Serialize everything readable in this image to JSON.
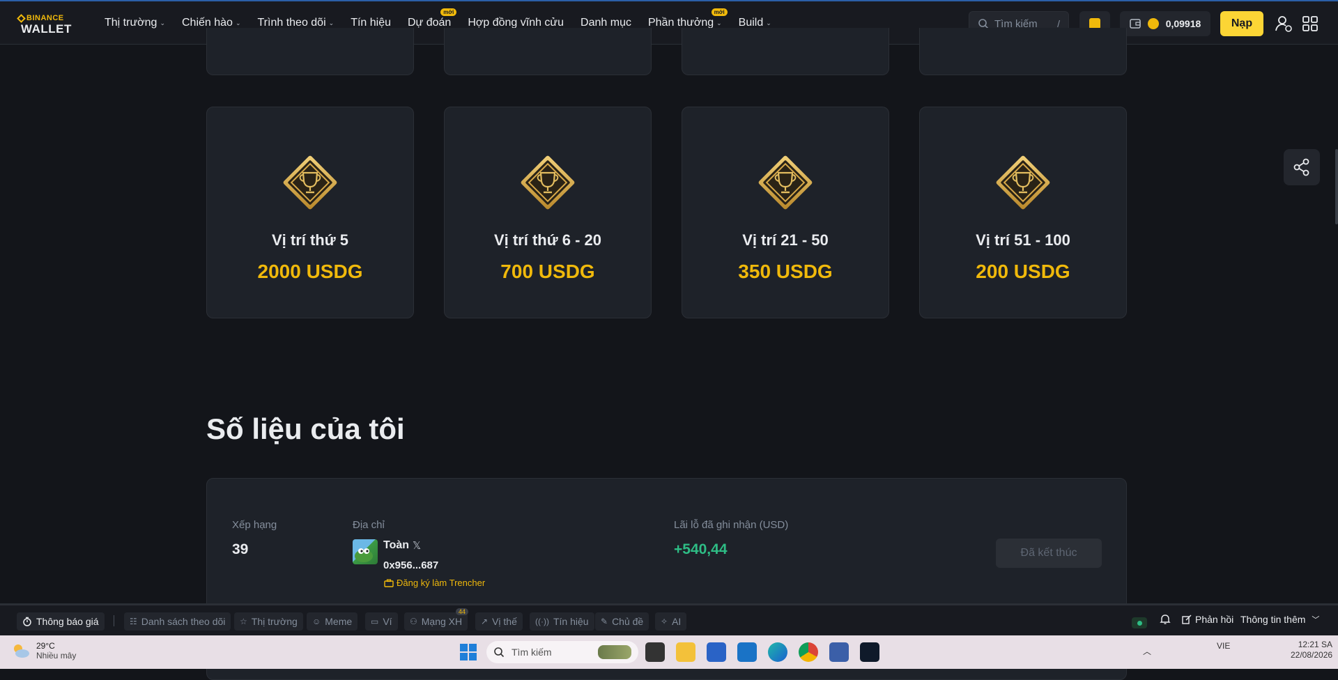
{
  "nav": {
    "logo_top": "BINANCE",
    "logo_bottom": "WALLET",
    "items": [
      {
        "label": "Thị trường",
        "dropdown": true,
        "badge": ""
      },
      {
        "label": "Chiến hào",
        "dropdown": true,
        "badge": ""
      },
      {
        "label": "Trình theo dõi",
        "dropdown": true,
        "badge": ""
      },
      {
        "label": "Tín hiệu",
        "dropdown": false,
        "badge": ""
      },
      {
        "label": "Dự đoán",
        "dropdown": false,
        "badge": "mới"
      },
      {
        "label": "Hợp đồng vĩnh cửu",
        "dropdown": false,
        "badge": ""
      },
      {
        "label": "Danh mục",
        "dropdown": false,
        "badge": ""
      },
      {
        "label": "Phần thưởng",
        "dropdown": true,
        "badge": "mới"
      },
      {
        "label": "Build",
        "dropdown": true,
        "badge": ""
      }
    ],
    "search_placeholder": "Tìm kiếm",
    "search_shortcut": "/",
    "balance": "0,09918",
    "deposit_label": "Nạp"
  },
  "prizes": [
    {
      "position": "Vị trí thứ 5",
      "amount": "2000 USDG"
    },
    {
      "position": "Vị trí thứ 6 - 20",
      "amount": "700 USDG"
    },
    {
      "position": "Vị trí 21 - 50",
      "amount": "350 USDG"
    },
    {
      "position": "Vị trí 51 - 100",
      "amount": "200 USDG"
    }
  ],
  "my_stats": {
    "title": "Số liệu của tôi",
    "rank_label": "Xếp hạng",
    "rank_value": "39",
    "address_label": "Địa chỉ",
    "user_name": "Toàn",
    "address_value": "0x956...687",
    "register_trencher": "Đăng ký làm Trencher",
    "pnl_label": "Lãi lỗ đã ghi nhận (USD)",
    "pnl_value": "+540,44",
    "ended_label": "Đã kết thúc",
    "colors": {
      "gain": "#2ebd85",
      "accent": "#f0b90b"
    }
  },
  "bottom_bar": {
    "price_alert": "Thông báo giá",
    "tabs": [
      "Danh sách theo dõi",
      "Thị trường",
      "Meme",
      "Ví",
      "Mạng XH",
      "Vị thế",
      "Tín hiệu",
      "Chủ đề",
      "AI"
    ],
    "social_badge": "44",
    "feedback": "Phản hồi",
    "more_info": "Thông tin thêm"
  },
  "taskbar": {
    "temperature": "29°C",
    "weather": "Nhiều mây",
    "search_placeholder": "Tìm kiếm",
    "lang": "VIE",
    "time": "12:21 SA",
    "date": "22/08/2026"
  }
}
